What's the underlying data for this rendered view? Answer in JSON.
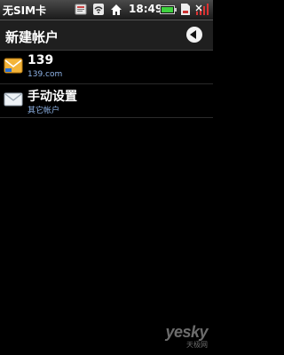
{
  "status_bar": {
    "carrier": "无SIM卡",
    "time": "18:49",
    "icons": [
      "message-icon",
      "wifi-icon",
      "home-icon",
      "battery-icon",
      "sd-card-icon",
      "signal-icon"
    ]
  },
  "header": {
    "title": "新建帐户",
    "back_icon": "back-arrow-icon"
  },
  "accounts": [
    {
      "name": "139",
      "subtitle": "139.com",
      "icon": "email-139-icon"
    },
    {
      "name": "手动设置",
      "subtitle": "其它帐户",
      "icon": "envelope-icon"
    }
  ],
  "watermark": {
    "brand": "yesky",
    "sub": "天极网"
  },
  "colors": {
    "background": "#000000",
    "status_bar": "#2e2e2e",
    "title_bar": "#1f1f1f",
    "subtitle_blue": "#8fb4e8",
    "battery_green": "#3fd13f"
  }
}
